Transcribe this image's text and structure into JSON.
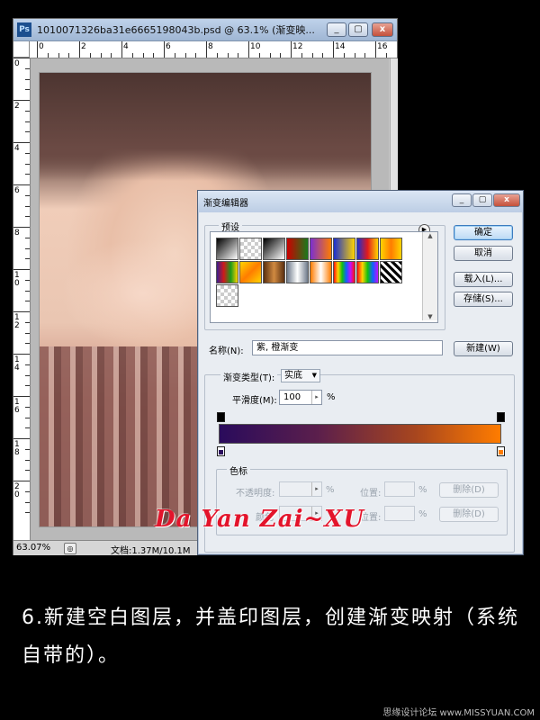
{
  "ps_window": {
    "title": "1010071326ba31e6665198043b.psd @ 63.1% (渐变映...",
    "app_icon": "Ps",
    "ruler_top_labels": [
      "0",
      "2",
      "4",
      "6",
      "8",
      "10",
      "12",
      "14",
      "16"
    ],
    "ruler_left_labels": [
      "0",
      "2",
      "4",
      "6",
      "8",
      "10",
      "12",
      "14",
      "16",
      "18",
      "20"
    ],
    "status_zoom": "63.07%",
    "status_doc": "文档:1.37M/10.1M"
  },
  "gradient_editor": {
    "title": "渐变编辑器",
    "presets_label": "预设",
    "buttons": {
      "ok": "确定",
      "cancel": "取消",
      "load": "载入(L)...",
      "save": "存储(S)...",
      "new": "新建(W)"
    },
    "name_label": "名称(N):",
    "name_value": "紫, 橙渐变",
    "gradient_type_label": "渐变类型(T):",
    "gradient_type_value": "实底",
    "smoothness_label": "平滑度(M):",
    "smoothness_value": "100",
    "percent": "%",
    "stops_group_label": "色标",
    "opacity_label": "不透明度:",
    "location_label": "位置:",
    "delete_label": "删除(D)",
    "color_label": "颜色",
    "stop_colors": {
      "start": "#2a0b5c",
      "end": "#ff7c00"
    },
    "preset_swatches": [
      "linear-gradient(135deg,#000,#fff)",
      "repeating-conic-gradient(#ccc 0 25%,#fff 0 50%) 0 0/8px 8px",
      "linear-gradient(135deg,#000,#fff)",
      "linear-gradient(90deg,#c00,#1a7a1a)",
      "linear-gradient(90deg,#7b2fd0,#ff7c00)",
      "linear-gradient(90deg,#1a2fd0,#ffd400)",
      "linear-gradient(90deg,#1a2fd0,#e21b1b,#ffd400)",
      "linear-gradient(90deg,#ffd400,#ff7c00,#ffd400)",
      "linear-gradient(90deg,#3a1f8f,#d01a1a,#1a9a1a,#ffd400)",
      "linear-gradient(135deg,#ffd400,#ff7c00,#ffd400)",
      "linear-gradient(90deg,#5a2f10,#d08a40,#5a2f10)",
      "linear-gradient(90deg,#6e7a8a,#fff,#6e7a8a)",
      "linear-gradient(90deg,#ff7c00,#fff,#ff7c00)",
      "linear-gradient(90deg,#ff1010,#ffd400,#10c010,#1060ff,#c010ff,#ff1010)",
      "linear-gradient(90deg,#ff1010,#ffd400,#10c010,#1060ff,#c010ff)",
      "repeating-linear-gradient(45deg,#000 0 3px,#fff 3px 6px)",
      "repeating-conic-gradient(#ccc 0 25%,#fff 0 50%) 0 0/8px 8px"
    ]
  },
  "signature": "Da Yan Zai~XU",
  "caption": "6.新建空白图层，并盖印图层，创建渐变映射（系统自带的）。",
  "credit": "思缘设计论坛 www.MISSYUAN.COM"
}
